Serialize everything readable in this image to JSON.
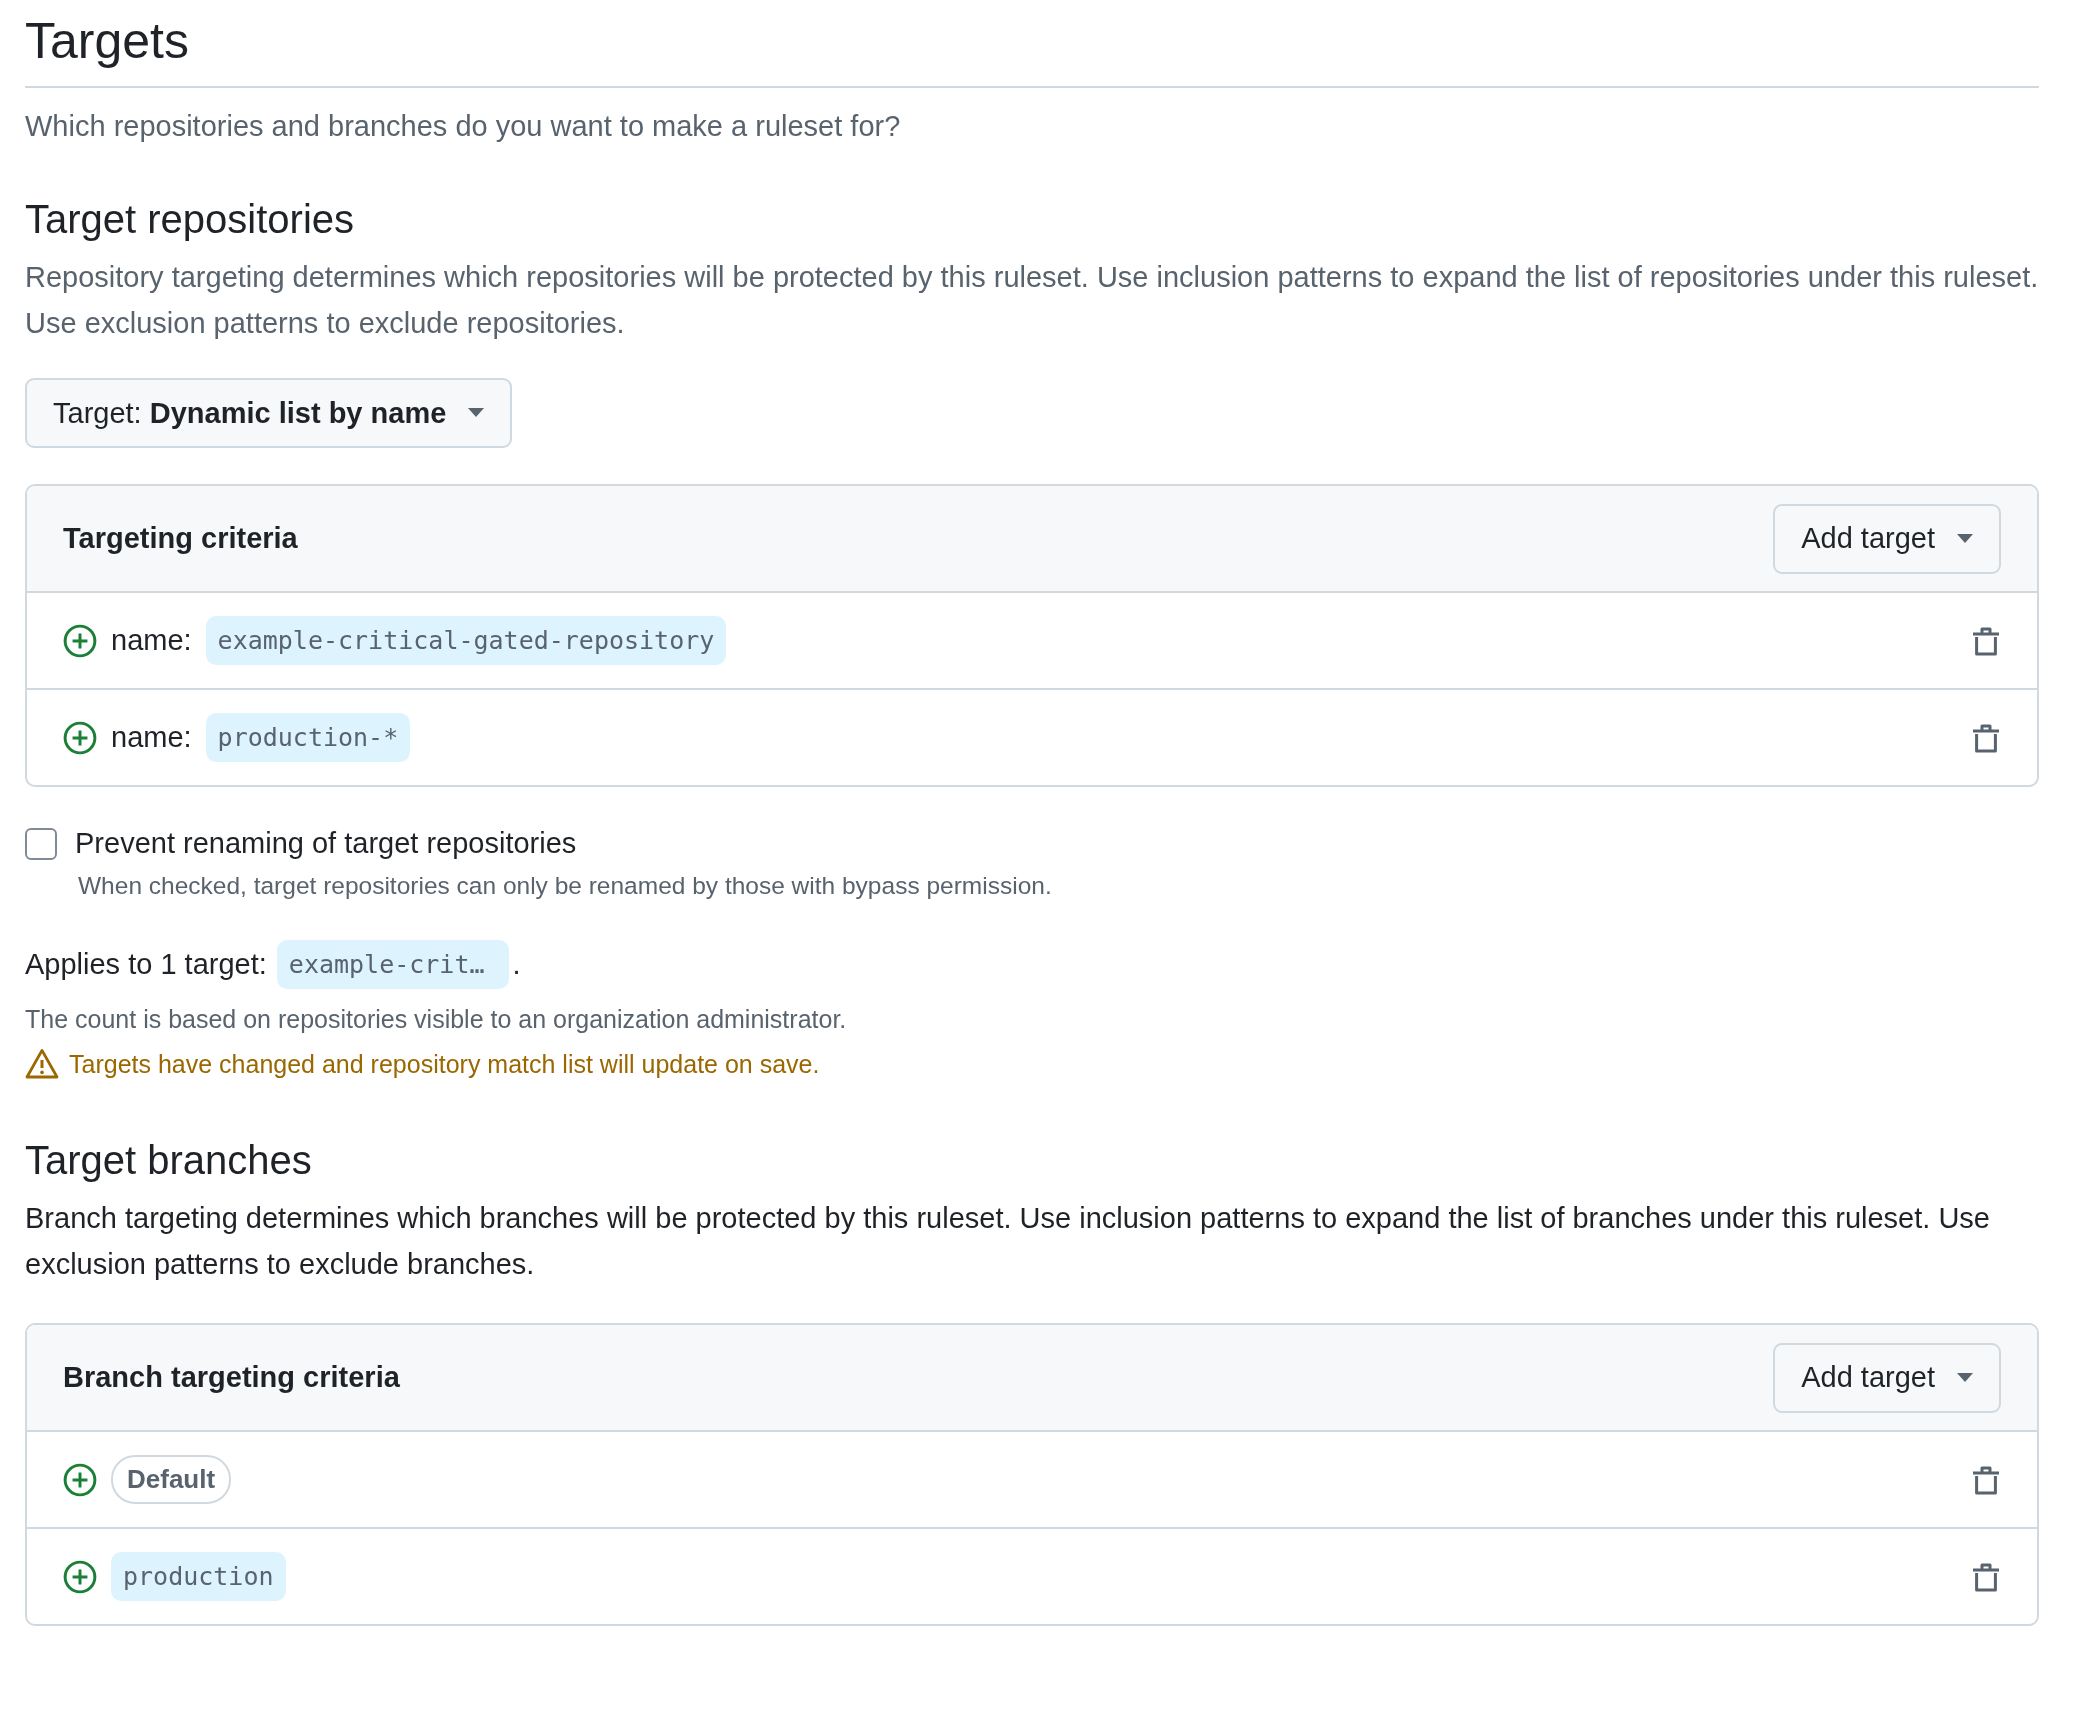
{
  "page": {
    "title": "Targets",
    "subtitle": "Which repositories and branches do you want to make a ruleset for?"
  },
  "target_repositories": {
    "heading": "Target repositories",
    "description": "Repository targeting determines which repositories will be protected by this ruleset. Use inclusion patterns to expand the list of repositories under this ruleset. Use exclusion patterns to exclude repositories.",
    "target_select": {
      "label": "Target:",
      "value": "Dynamic list by name"
    },
    "criteria": {
      "title": "Targeting criteria",
      "add_button": "Add target",
      "rows": [
        {
          "kind": "name",
          "label": "name:",
          "pattern": "example-critical-gated-repository"
        },
        {
          "kind": "name",
          "label": "name:",
          "pattern": "production-*"
        }
      ]
    },
    "prevent_renaming": {
      "label": "Prevent renaming of target repositories",
      "help": "When checked, target repositories can only be renamed by those with bypass permission.",
      "checked": false
    },
    "applies": {
      "label": "Applies to 1 target:",
      "target": "example-crit…",
      "end": "."
    },
    "count_note": "The count is based on repositories visible to an organization administrator.",
    "warning": "Targets have changed and repository match list will update on save."
  },
  "target_branches": {
    "heading": "Target branches",
    "description": "Branch targeting determines which branches will be protected by this ruleset. Use inclusion patterns to expand the list of branches under this ruleset. Use exclusion patterns to exclude branches.",
    "criteria": {
      "title": "Branch targeting criteria",
      "add_button": "Add target",
      "rows": [
        {
          "kind": "default",
          "pattern": "Default"
        },
        {
          "kind": "pattern",
          "pattern": "production"
        }
      ]
    }
  }
}
